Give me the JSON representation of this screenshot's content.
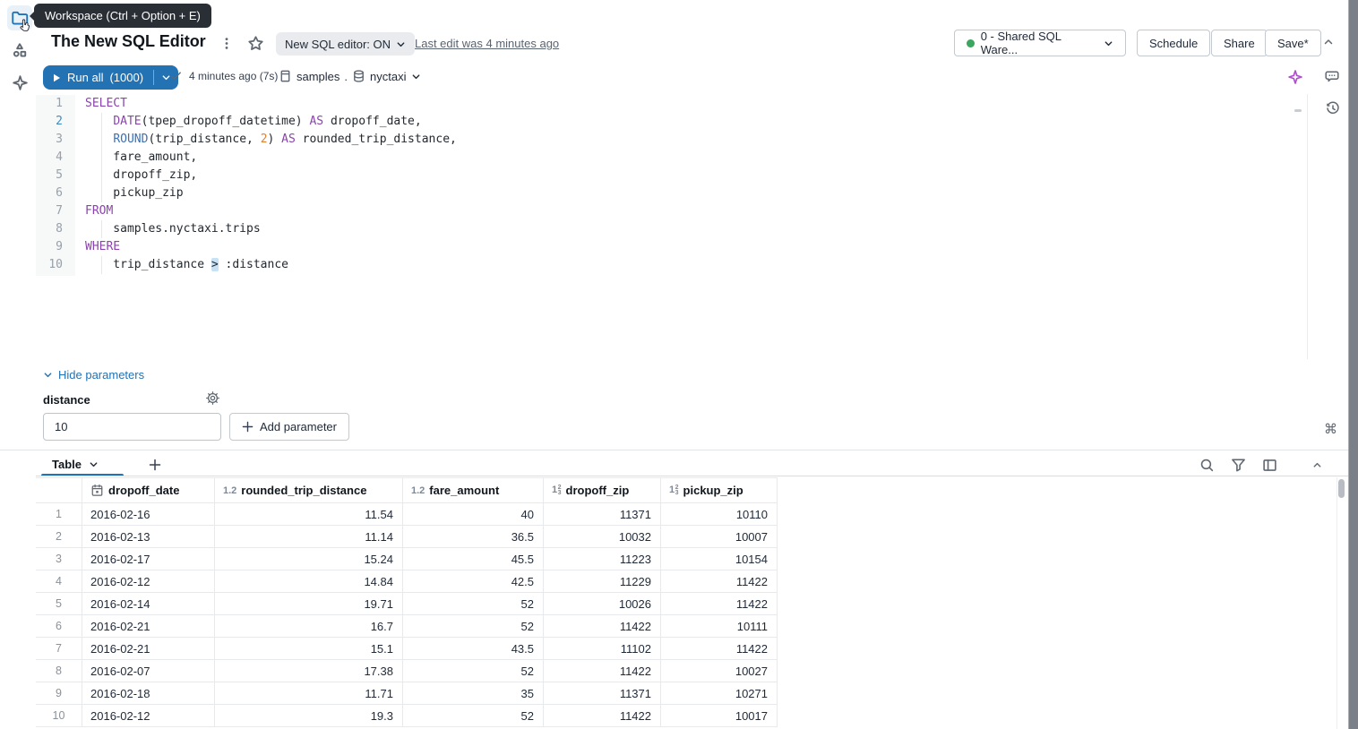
{
  "tooltip": {
    "text": "Workspace (Ctrl + Option + E)"
  },
  "header": {
    "title": "The New SQL Editor",
    "editor_toggle_label": "New SQL editor: ON",
    "last_edit": "Last edit was 4 minutes ago",
    "warehouse_label": "0 - Shared SQL Ware...",
    "schedule_label": "Schedule",
    "share_label": "Share",
    "save_label": "Save*"
  },
  "toolbar": {
    "run_label": "Run all",
    "run_count": "(1000)",
    "last_run": "4 minutes ago (7s)",
    "catalog": "samples",
    "separator": ".",
    "schema": "nyctaxi"
  },
  "editor": {
    "lines": [
      {
        "n": "1",
        "seg": [
          [
            "kw",
            "SELECT"
          ]
        ]
      },
      {
        "n": "2",
        "active": true,
        "indent": true,
        "seg": [
          [
            "pl",
            "    "
          ],
          [
            "kw",
            "DATE"
          ],
          [
            "pl",
            "(tpep_dropoff_datetime) "
          ],
          [
            "kw",
            "AS"
          ],
          [
            "pl",
            " dropoff_date,"
          ]
        ]
      },
      {
        "n": "3",
        "indent": true,
        "seg": [
          [
            "pl",
            "    "
          ],
          [
            "fn",
            "ROUND"
          ],
          [
            "pl",
            "(trip_distance, "
          ],
          [
            "num",
            "2"
          ],
          [
            "pl",
            ") "
          ],
          [
            "kw",
            "AS"
          ],
          [
            "pl",
            " rounded_trip_distance,"
          ]
        ]
      },
      {
        "n": "4",
        "indent": true,
        "seg": [
          [
            "pl",
            "    fare_amount,"
          ]
        ]
      },
      {
        "n": "5",
        "indent": true,
        "seg": [
          [
            "pl",
            "    dropoff_zip,"
          ]
        ]
      },
      {
        "n": "6",
        "indent": true,
        "seg": [
          [
            "pl",
            "    pickup_zip"
          ]
        ]
      },
      {
        "n": "7",
        "seg": [
          [
            "kw",
            "FROM"
          ]
        ]
      },
      {
        "n": "8",
        "indent": true,
        "seg": [
          [
            "pl",
            "    samples.nyctaxi.trips"
          ]
        ]
      },
      {
        "n": "9",
        "seg": [
          [
            "kw",
            "WHERE"
          ]
        ]
      },
      {
        "n": "10",
        "indent": true,
        "seg": [
          [
            "pl",
            "    trip_distance "
          ],
          [
            "op",
            ">"
          ],
          [
            "pl",
            " :distance"
          ]
        ]
      }
    ]
  },
  "parameters": {
    "hide_label": "Hide parameters",
    "name": "distance",
    "value": "10",
    "add_label": "Add parameter"
  },
  "results": {
    "tab_label": "Table",
    "columns": [
      {
        "type": "date",
        "label": "dropoff_date"
      },
      {
        "type": "decimal",
        "label": "rounded_trip_distance"
      },
      {
        "type": "decimal",
        "label": "fare_amount"
      },
      {
        "type": "integer",
        "label": "dropoff_zip"
      },
      {
        "type": "integer",
        "label": "pickup_zip"
      }
    ],
    "rows": [
      [
        "2016-02-16",
        "11.54",
        "40",
        "11371",
        "10110"
      ],
      [
        "2016-02-13",
        "11.14",
        "36.5",
        "10032",
        "10007"
      ],
      [
        "2016-02-17",
        "15.24",
        "45.5",
        "11223",
        "10154"
      ],
      [
        "2016-02-12",
        "14.84",
        "42.5",
        "11229",
        "11422"
      ],
      [
        "2016-02-14",
        "19.71",
        "52",
        "10026",
        "11422"
      ],
      [
        "2016-02-21",
        "16.7",
        "52",
        "11422",
        "10111"
      ],
      [
        "2016-02-21",
        "15.1",
        "43.5",
        "11102",
        "11422"
      ],
      [
        "2016-02-07",
        "17.38",
        "52",
        "11422",
        "10027"
      ],
      [
        "2016-02-18",
        "11.71",
        "35",
        "11371",
        "10271"
      ],
      [
        "2016-02-12",
        "19.3",
        "52",
        "11422",
        "10017"
      ]
    ]
  },
  "icons": {
    "command_glyph": "⌘",
    "decimal_type": "1.2",
    "integer_type_parts": [
      "1",
      "2",
      "3"
    ]
  }
}
